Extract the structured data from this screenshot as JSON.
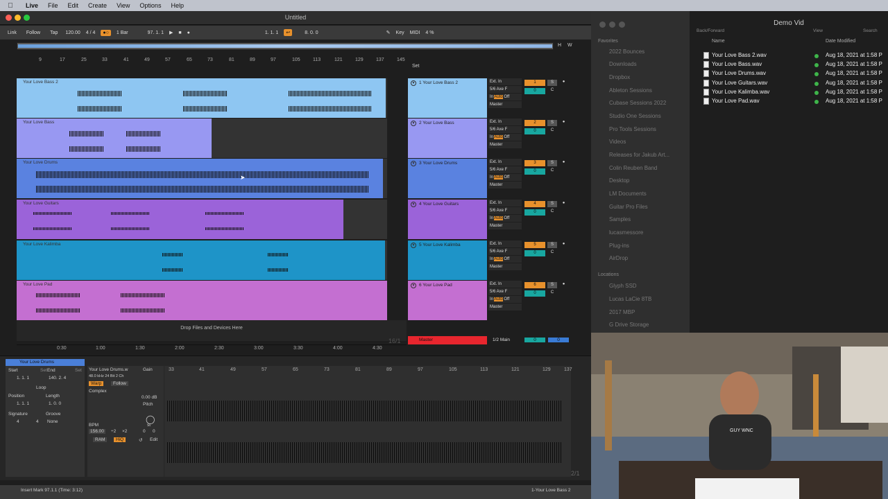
{
  "menubar": {
    "items": [
      "Live",
      "File",
      "Edit",
      "Create",
      "View",
      "Options",
      "Help"
    ]
  },
  "window": {
    "title": "Untitled"
  },
  "control_bar": {
    "link": "Link",
    "follow": "Follow",
    "tap": "Tap",
    "tempo": "120.00",
    "signature": "4 / 4",
    "quantize": "1 Bar",
    "position": "97.  1.  1",
    "loop_start": "1.  1.  1",
    "loop_length": "8.  0.  0",
    "key": "Key",
    "midi": "MIDI",
    "cpu": "4 %",
    "overview_h": "H",
    "overview_w": "W"
  },
  "arrangement": {
    "ruler": [
      "9",
      "17",
      "25",
      "33",
      "41",
      "49",
      "57",
      "65",
      "73",
      "81",
      "89",
      "97",
      "105",
      "113",
      "121",
      "129",
      "137",
      "145"
    ],
    "set_label": "Set",
    "time_ruler": [
      "0:30",
      "1:00",
      "1:30",
      "2:00",
      "2:30",
      "3:00",
      "3:30",
      "4:00",
      "4:30"
    ],
    "drop_label": "Drop Files and Devices Here",
    "bar_counter": "16/1",
    "tracks": [
      {
        "clip": "Your Love Bass 2",
        "head": "1 Your Love Bass 2",
        "input": "Ext. In",
        "channel": "5/6 Axe F",
        "monitor_in": "In",
        "monitor_auto": "Auto",
        "monitor_off": "Off",
        "output": "Master",
        "num": "1",
        "vol": "0",
        "solo": "S",
        "pan": "C",
        "color": "#8ec6f2"
      },
      {
        "clip": "Your Love Bass",
        "head": "2 Your Love Bass",
        "input": "Ext. In",
        "channel": "5/6 Axe F",
        "monitor_in": "In",
        "monitor_auto": "Auto",
        "monitor_off": "Off",
        "output": "Master",
        "num": "2",
        "vol": "0",
        "solo": "S",
        "pan": "C",
        "color": "#9898f2"
      },
      {
        "clip": "Your Love Drums",
        "head": "3 Your Love Drums",
        "input": "Ext. In",
        "channel": "5/6 Axe F",
        "monitor_in": "In",
        "monitor_auto": "Auto",
        "monitor_off": "Off",
        "output": "Master",
        "num": "3",
        "vol": "0",
        "solo": "S",
        "pan": "C",
        "color": "#5a82e0"
      },
      {
        "clip": "Your Love Guitars",
        "head": "4 Your Love Guitars",
        "input": "Ext. In",
        "channel": "5/6 Axe F",
        "monitor_in": "In",
        "monitor_auto": "Auto",
        "monitor_off": "Off",
        "output": "Master",
        "num": "4",
        "vol": "0",
        "solo": "S",
        "pan": "C",
        "color": "#9b63d9"
      },
      {
        "clip": "Your Love Kalimba",
        "head": "5 Your Love Kalimba",
        "input": "Ext. In",
        "channel": "5/6 Axe F",
        "monitor_in": "In",
        "monitor_auto": "Auto",
        "monitor_off": "Off",
        "output": "Master",
        "num": "5",
        "vol": "0",
        "solo": "S",
        "pan": "C",
        "color": "#1e94c8"
      },
      {
        "clip": "Your Love Pad",
        "head": "6 Your Love Pad",
        "input": "Ext. In",
        "channel": "5/6 Axe F",
        "monitor_in": "In",
        "monitor_auto": "Auto",
        "monitor_off": "Off",
        "output": "Master",
        "num": "6",
        "vol": "0",
        "solo": "S",
        "pan": "C",
        "color": "#c46fd1"
      }
    ],
    "master": {
      "label": "Master",
      "output": "1/2 Main",
      "vol": "0",
      "extra": "0"
    }
  },
  "detail": {
    "clip_name": "Your Love Drums",
    "start_label": "Start",
    "end_label": "End",
    "set_label": "Set",
    "start_value": "1.  1.  1",
    "end_value": "140.  2.  4",
    "loop": "Loop",
    "position": "Position",
    "length": "Length",
    "position_value": "1.  1.  1",
    "length_value": "1.  0.  0",
    "signature": "Signature",
    "groove": "Groove",
    "sig_num": "4",
    "sig_den": "4",
    "groove_value": "None",
    "sample_name": "Your Love Drums.w",
    "sample_info": "48.0 kHz  24 Bit  2 Ch",
    "warp": "Warp",
    "follow": "Follow",
    "warp_mode": "Complex",
    "gain": "Gain",
    "gain_value": "0.00 dB",
    "pitch": "Pitch",
    "st": "st",
    "pitch_value": "0",
    "cents": "0",
    "bpm": "BPM",
    "bpm_value": "156.00",
    "halve": "÷2",
    "double": "×2",
    "ram": "RAM",
    "hiq": "HiQ",
    "edit": "Edit",
    "ruler": [
      "33",
      "41",
      "49",
      "57",
      "65",
      "73",
      "81",
      "89",
      "97",
      "105",
      "113",
      "121",
      "129",
      "137"
    ],
    "zoom": "2/1"
  },
  "status": {
    "text": "Insert Mark 97.1.1 (Time: 3:12)",
    "track": "1-Your Love Bass 2"
  },
  "finder": {
    "title": "Demo Vid",
    "back_label": "Back/Forward",
    "view_label": "View",
    "search_label": "Search",
    "favorites_label": "Favorites",
    "favorites": [
      "2022 Bounces",
      "Downloads",
      "Dropbox",
      "Ableton Sessions",
      "Cubase Sessions 2022",
      "Studio One Sessions",
      "Pro Tools Sessions",
      "Videos",
      "Releases for Jakub Art...",
      "Colin Reuben Band",
      "Desktop",
      "LM Documents",
      "Guitar Pro Files",
      "Samples",
      "lucasmessore",
      "Plug-ins",
      "AirDrop"
    ],
    "locations_label": "Locations",
    "locations": [
      "Glyph SSD",
      "Lucas LaCie 8TB",
      "2017 MBP",
      "G Drive Storage"
    ],
    "col_name": "Name",
    "col_date": "Date Modified",
    "files": [
      {
        "name": "Your Love Bass 2.wav",
        "date": "Aug 18, 2021 at 1:58 P"
      },
      {
        "name": "Your Love Bass.wav",
        "date": "Aug 18, 2021 at 1:58 P"
      },
      {
        "name": "Your Love Drums.wav",
        "date": "Aug 18, 2021 at 1:58 P"
      },
      {
        "name": "Your Love Guitars.wav",
        "date": "Aug 18, 2021 at 1:58 P"
      },
      {
        "name": "Your Love Kalimba.wav",
        "date": "Aug 18, 2021 at 1:58 P"
      },
      {
        "name": "Your Love Pad.wav",
        "date": "Aug 18, 2021 at 1:58 P"
      }
    ]
  },
  "webcam": {
    "shirt_text": "GUY WNC"
  }
}
